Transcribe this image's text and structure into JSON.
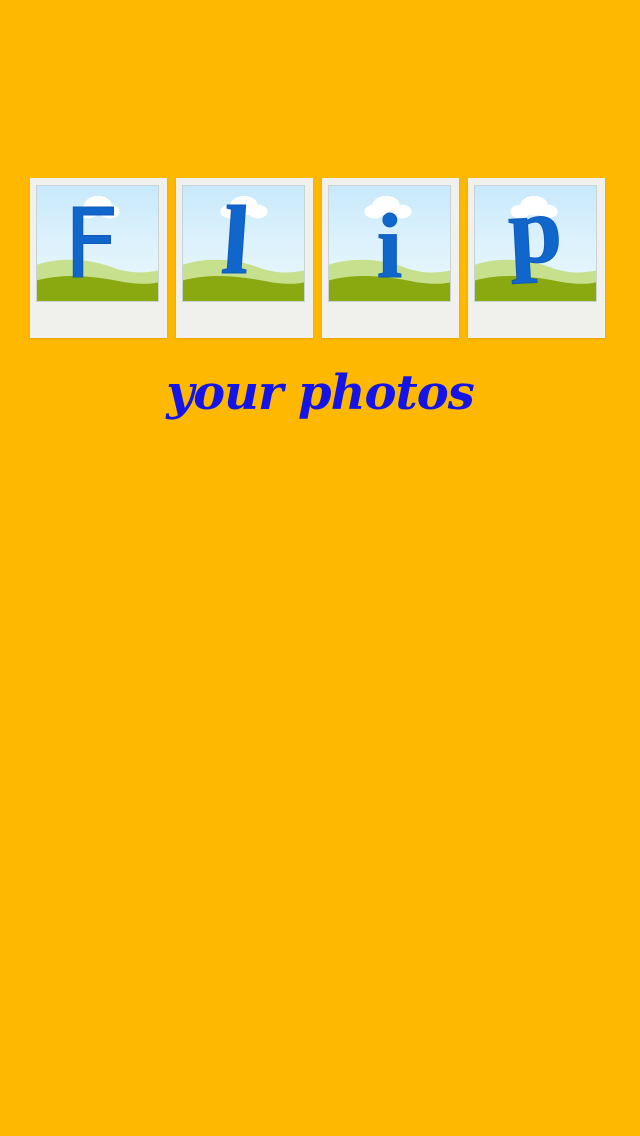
{
  "app": {
    "background_color": "#FFB800",
    "logo": {
      "letters": [
        "F",
        "l",
        "i",
        "p"
      ],
      "letter_color": "#1166CC",
      "frame_color": "#F0F1EC"
    },
    "tagline": "your photos",
    "tagline_color": "#1414E6"
  }
}
